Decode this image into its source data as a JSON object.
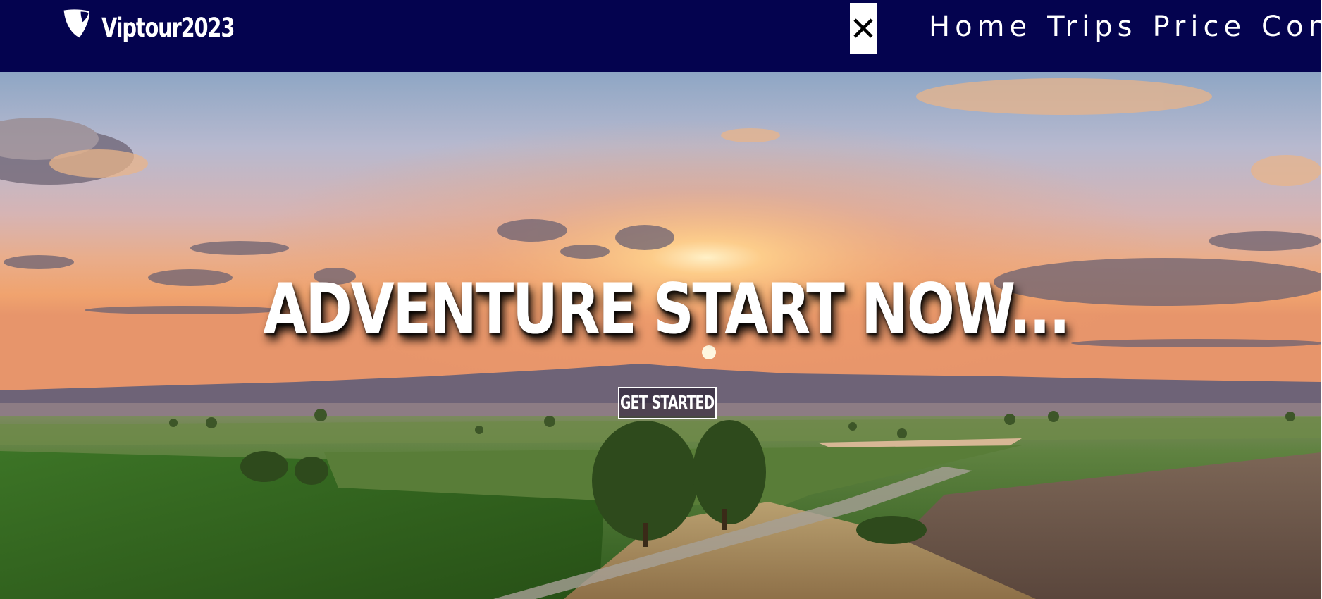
{
  "brand": {
    "name": "Viptour2023",
    "logo_icon": "typo3-logo-icon"
  },
  "nav": {
    "close_icon": "close-icon",
    "links": [
      {
        "label": "Home"
      },
      {
        "label": "Trips"
      },
      {
        "label": "Price"
      },
      {
        "label": "Contact"
      }
    ]
  },
  "hero": {
    "title": "ADVENTURE START NOW...",
    "cta_label": "GET STARTED",
    "background": "sunset-over-farmland-image"
  },
  "colors": {
    "nav_background": "#04034f",
    "text": "#ffffff"
  }
}
